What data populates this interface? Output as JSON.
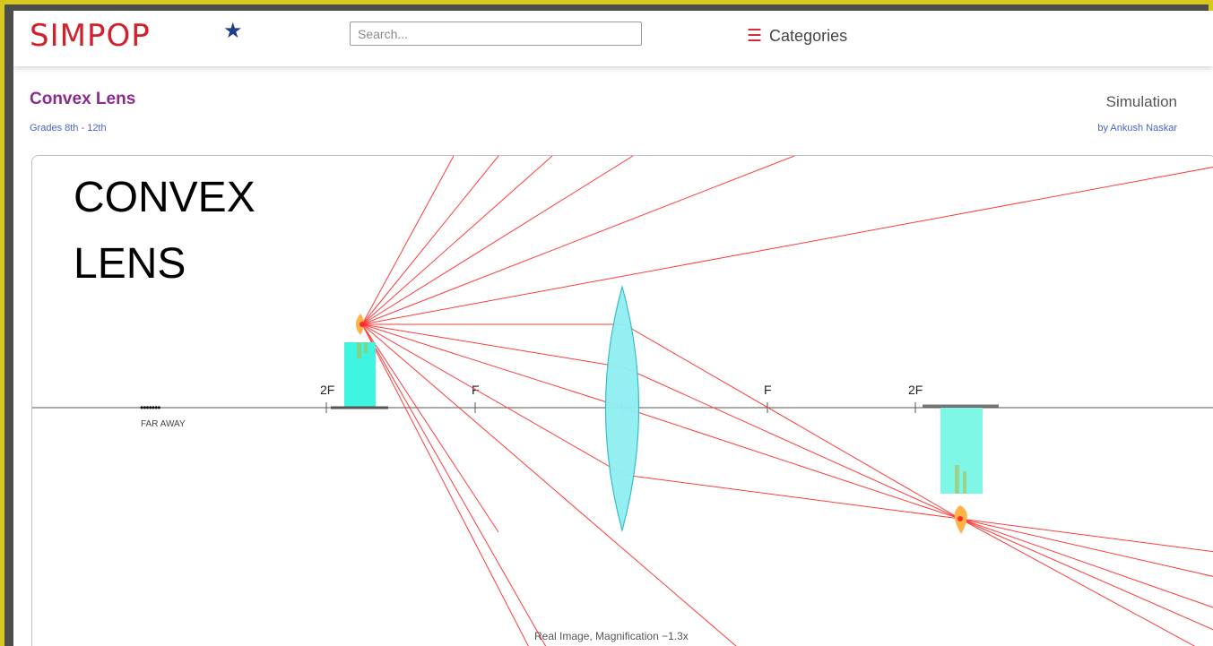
{
  "header": {
    "logo": "SIMPOP",
    "logo_star": "★",
    "search_placeholder": "Search...",
    "categories_label": "Categories",
    "categories_icon": "☰"
  },
  "page_info": {
    "title": "Convex Lens",
    "grades": "Grades 8th - 12th",
    "type_label": "Simulation",
    "author": "by Ankush Naskar"
  },
  "simulation": {
    "overlay_title_line1": "CONVEX",
    "overlay_title_line2": "LENS",
    "label_2f_left": "2F",
    "label_f_left": "F",
    "label_f_right": "F",
    "label_2f_right": "2F",
    "far_away_label": "FAR AWAY",
    "far_away_dots": "•••••••",
    "status_text": "Real Image, Magnification −1.3x",
    "colors": {
      "ray": "#ff3b3b",
      "lens_fill": "#8ff0f0",
      "candle_body": "#3ff5e0",
      "image_body": "#7ff7e6",
      "flame": "#ffb347",
      "axis": "#555555"
    }
  }
}
